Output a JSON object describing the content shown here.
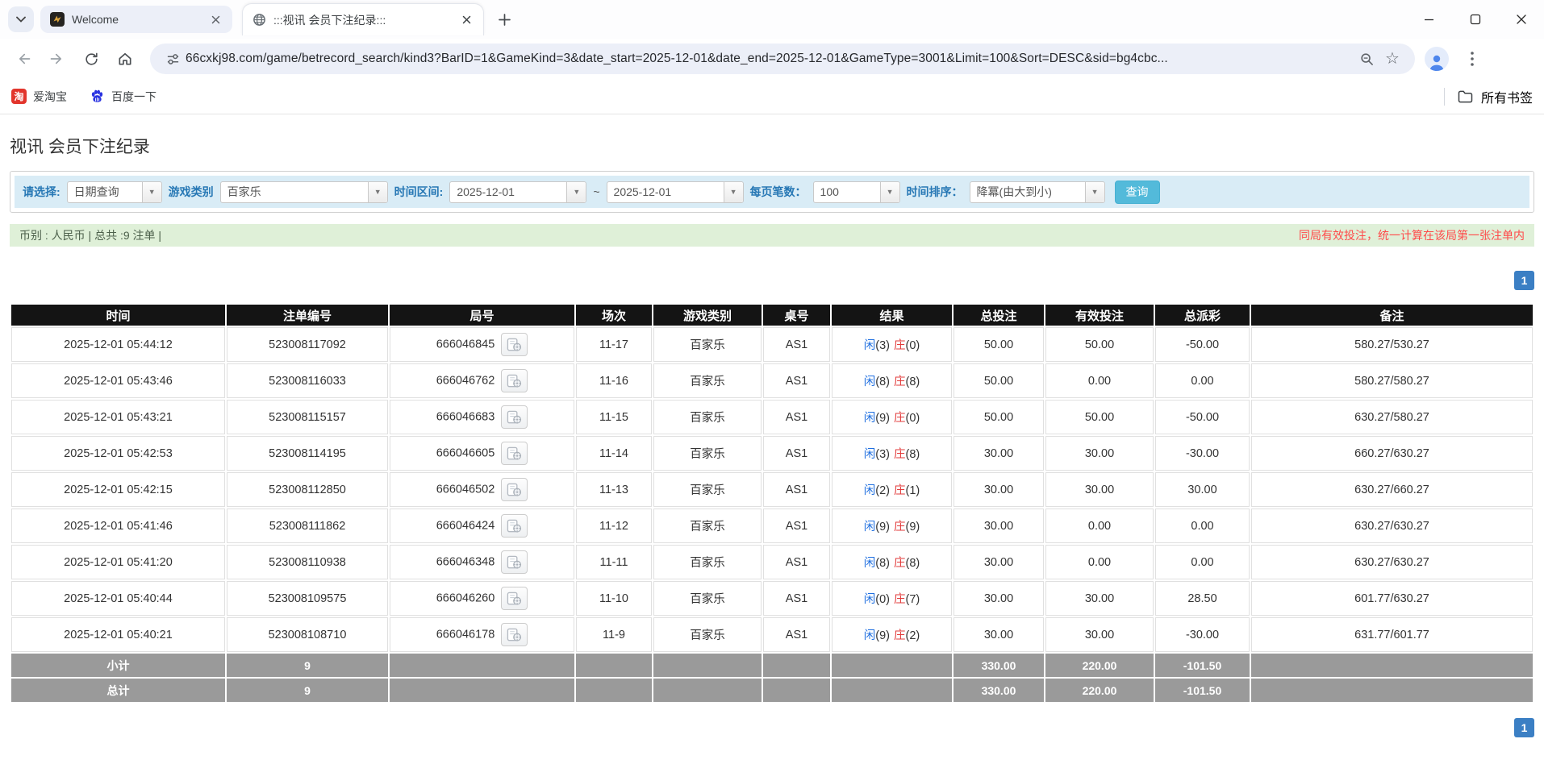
{
  "browser": {
    "tabs": [
      {
        "title": "Welcome"
      },
      {
        "title": ":::视讯 会员下注纪录:::"
      }
    ],
    "url": "66cxkj98.com/game/betrecord_search/kind3?BarID=1&GameKind=3&date_start=2025-12-01&date_end=2025-12-01&GameType=3001&Limit=100&Sort=DESC&sid=bg4cbc...",
    "bookmarks": {
      "item1": "爱淘宝",
      "item2": "百度一下",
      "all_bookmarks": "所有书签"
    }
  },
  "page": {
    "title": "视讯 会员下注纪录",
    "filters": {
      "select_label": "请选择:",
      "select_value": "日期查询",
      "game_label": "游戏类别",
      "game_value": "百家乐",
      "range_label": "时间区间:",
      "date_start": "2025-12-01",
      "tilde": "~",
      "date_end": "2025-12-01",
      "per_page_label": "每页笔数：",
      "per_page_value": "100",
      "sort_label": "时间排序：",
      "sort_value": "降冪(由大到小)",
      "search_button": "查询"
    },
    "info_bar": {
      "left": "币别 : 人民币 | 总共 :9 注单 |",
      "right": "同局有效投注，统一计算在该局第一张注单内"
    },
    "pagination": "1",
    "table": {
      "headers": [
        "时间",
        "注单编号",
        "局号",
        "场次",
        "游戏类别",
        "桌号",
        "结果",
        "总投注",
        "有效投注",
        "总派彩",
        "备注"
      ],
      "result_player_label": "闲",
      "result_banker_label": "庄",
      "rows": [
        {
          "time": "2025-12-01 05:44:12",
          "bet_id": "523008117092",
          "round": "666046845",
          "session": "11-17",
          "game": "百家乐",
          "table": "AS1",
          "player": "(3)",
          "banker": "(0)",
          "total_bet": "50.00",
          "valid_bet": "50.00",
          "payout": "-50.00",
          "note": "580.27/530.27"
        },
        {
          "time": "2025-12-01 05:43:46",
          "bet_id": "523008116033",
          "round": "666046762",
          "session": "11-16",
          "game": "百家乐",
          "table": "AS1",
          "player": "(8)",
          "banker": "(8)",
          "total_bet": "50.00",
          "valid_bet": "0.00",
          "payout": "0.00",
          "note": "580.27/580.27"
        },
        {
          "time": "2025-12-01 05:43:21",
          "bet_id": "523008115157",
          "round": "666046683",
          "session": "11-15",
          "game": "百家乐",
          "table": "AS1",
          "player": "(9)",
          "banker": "(0)",
          "total_bet": "50.00",
          "valid_bet": "50.00",
          "payout": "-50.00",
          "note": "630.27/580.27"
        },
        {
          "time": "2025-12-01 05:42:53",
          "bet_id": "523008114195",
          "round": "666046605",
          "session": "11-14",
          "game": "百家乐",
          "table": "AS1",
          "player": "(3)",
          "banker": "(8)",
          "total_bet": "30.00",
          "valid_bet": "30.00",
          "payout": "-30.00",
          "note": "660.27/630.27"
        },
        {
          "time": "2025-12-01 05:42:15",
          "bet_id": "523008112850",
          "round": "666046502",
          "session": "11-13",
          "game": "百家乐",
          "table": "AS1",
          "player": "(2)",
          "banker": "(1)",
          "total_bet": "30.00",
          "valid_bet": "30.00",
          "payout": "30.00",
          "note": "630.27/660.27"
        },
        {
          "time": "2025-12-01 05:41:46",
          "bet_id": "523008111862",
          "round": "666046424",
          "session": "11-12",
          "game": "百家乐",
          "table": "AS1",
          "player": "(9)",
          "banker": "(9)",
          "total_bet": "30.00",
          "valid_bet": "0.00",
          "payout": "0.00",
          "note": "630.27/630.27"
        },
        {
          "time": "2025-12-01 05:41:20",
          "bet_id": "523008110938",
          "round": "666046348",
          "session": "11-11",
          "game": "百家乐",
          "table": "AS1",
          "player": "(8)",
          "banker": "(8)",
          "total_bet": "30.00",
          "valid_bet": "0.00",
          "payout": "0.00",
          "note": "630.27/630.27"
        },
        {
          "time": "2025-12-01 05:40:44",
          "bet_id": "523008109575",
          "round": "666046260",
          "session": "11-10",
          "game": "百家乐",
          "table": "AS1",
          "player": "(0)",
          "banker": "(7)",
          "total_bet": "30.00",
          "valid_bet": "30.00",
          "payout": "28.50",
          "note": "601.77/630.27"
        },
        {
          "time": "2025-12-01 05:40:21",
          "bet_id": "523008108710",
          "round": "666046178",
          "session": "11-9",
          "game": "百家乐",
          "table": "AS1",
          "player": "(9)",
          "banker": "(2)",
          "total_bet": "30.00",
          "valid_bet": "30.00",
          "payout": "-30.00",
          "note": "631.77/601.77"
        }
      ],
      "subtotal": {
        "label": "小计",
        "count": "9",
        "total_bet": "330.00",
        "valid_bet": "220.00",
        "payout": "-101.50"
      },
      "total": {
        "label": "总计",
        "count": "9",
        "total_bet": "330.00",
        "valid_bet": "220.00",
        "payout": "-101.50"
      }
    }
  }
}
